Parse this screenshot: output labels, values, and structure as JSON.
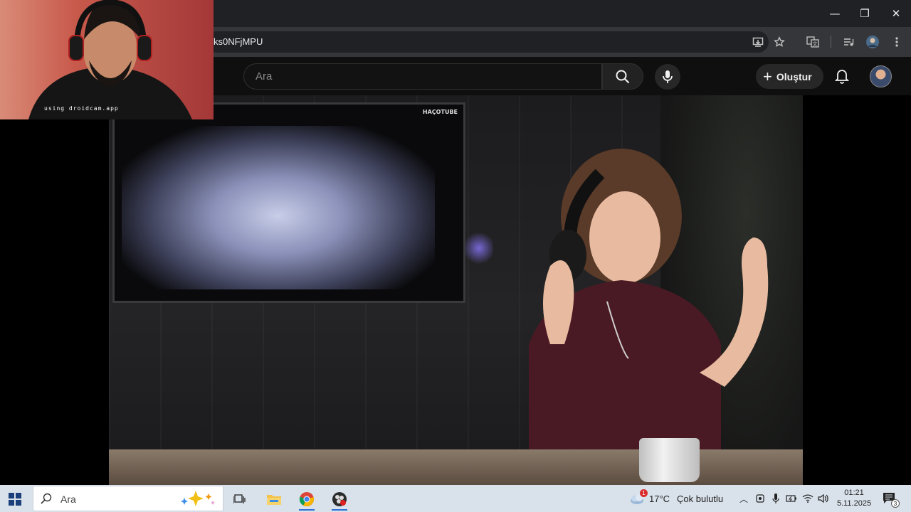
{
  "browser": {
    "url": "ks0NFjMPU",
    "window_controls": {
      "minimize": "—",
      "restore": "❐",
      "close": "✕"
    },
    "toolbar_icons": [
      "install-app-icon",
      "bookmark-star-icon",
      "translate-icon",
      "media-controls-icon",
      "profile-icon",
      "more-menu-icon"
    ]
  },
  "youtube": {
    "search_placeholder": "Ara",
    "create_label": "Oluştur"
  },
  "video": {
    "watermark": "HAÇOTUBE"
  },
  "webcam": {
    "label": "using droidcam.app"
  },
  "taskbar": {
    "search_placeholder": "Ara",
    "weather_temp": "17°C",
    "weather_desc": "Çok bulutlu",
    "weather_badge": "1",
    "time": "01:21",
    "date": "5.11.2025",
    "notification_count": "3",
    "apps": [
      "task-view",
      "file-explorer",
      "chrome",
      "obs"
    ]
  },
  "colors": {
    "yt_bg": "#0f0f0f",
    "chrome_dark": "#202124",
    "taskbar_bg": "#d9e1ea"
  }
}
